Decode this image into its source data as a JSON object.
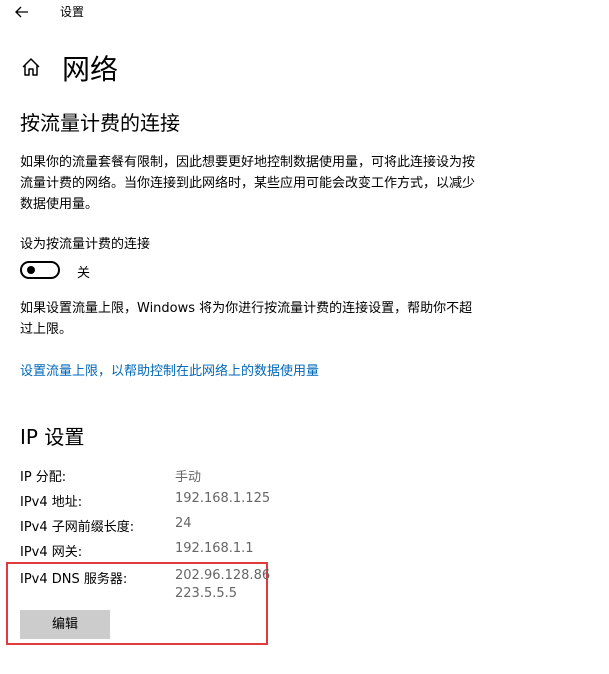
{
  "window": {
    "title": "设置"
  },
  "page": {
    "title": "网络"
  },
  "metered": {
    "heading": "按流量计费的连接",
    "description": "如果你的流量套餐有限制，因此想要更好地控制数据使用量，可将此连接设为按流量计费的网络。当你连接到此网络时，某些应用可能会改变工作方式，以减少数据使用量。",
    "toggle_label": "设为按流量计费的连接",
    "toggle_state": "关",
    "toggle_on": false,
    "limit_note": "如果设置流量上限，Windows 将为你进行按流量计费的连接设置，帮助你不超过上限。",
    "limit_link": "设置流量上限，以帮助控制在此网络上的数据使用量"
  },
  "ip": {
    "heading": "IP 设置",
    "rows": [
      {
        "key": "IP 分配:",
        "value": "手动"
      },
      {
        "key": "IPv4 地址:",
        "value": "192.168.1.125"
      },
      {
        "key": "IPv4 子网前缀长度:",
        "value": "24"
      },
      {
        "key": "IPv4 网关:",
        "value": "192.168.1.1"
      }
    ],
    "dns_key": "IPv4 DNS 服务器:",
    "dns_values": [
      "202.96.128.86",
      "223.5.5.5"
    ],
    "edit_label": "编辑"
  },
  "colors": {
    "accent_link": "#0067b8",
    "highlight_box": "#e0393e",
    "button_bg": "#cccccc",
    "value_text": "#666666"
  },
  "icons": {
    "back": "back-arrow-icon",
    "home": "home-icon"
  }
}
